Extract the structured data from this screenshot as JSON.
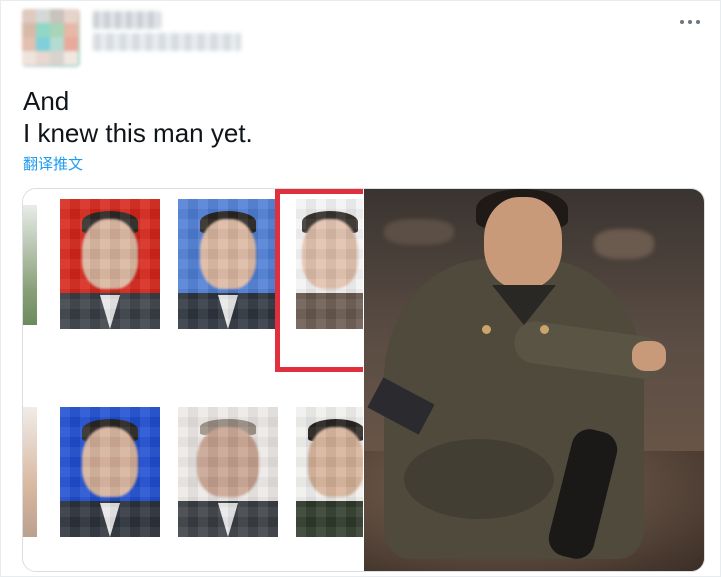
{
  "tweet": {
    "lines": [
      "And",
      "I knew this man yet."
    ],
    "translate_label": "翻译推文"
  },
  "icons": {
    "more": "more-horizontal-icon"
  },
  "colors": {
    "link": "#1d9bf0",
    "highlight_border": "#e0303d",
    "text": "#0f1419"
  }
}
